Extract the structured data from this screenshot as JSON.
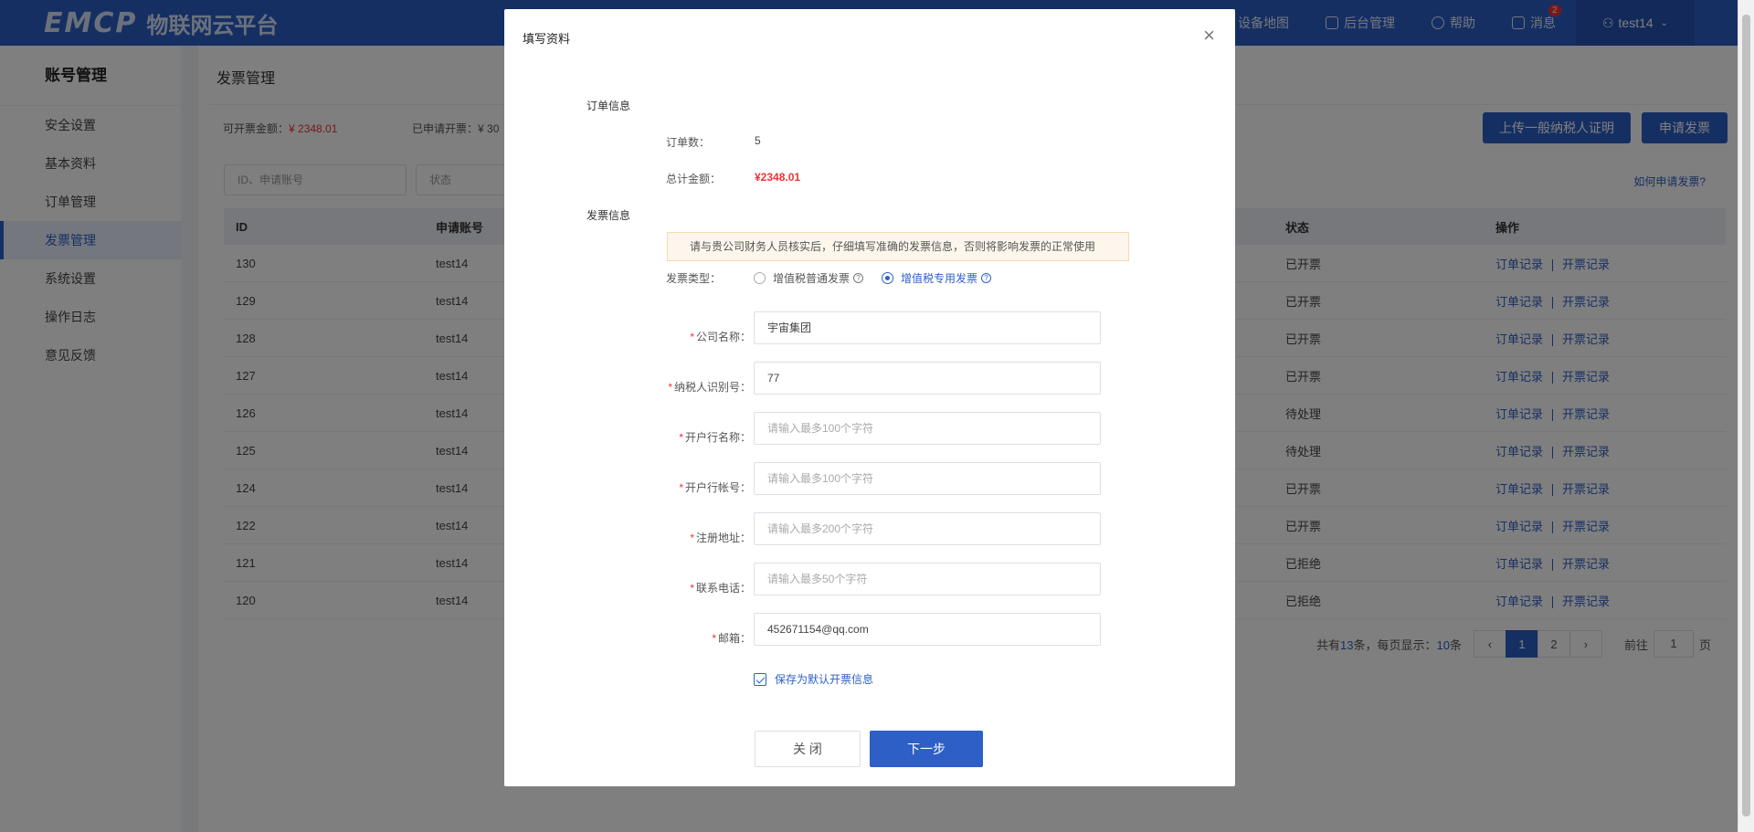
{
  "header": {
    "logo_mark": "EMCP",
    "logo_text": "物联网云平台",
    "nav": [
      {
        "label": "设备地图",
        "icon": "user-pin-icon"
      },
      {
        "label": "后台管理",
        "icon": "monitor-icon"
      },
      {
        "label": "帮助",
        "icon": "help-circle-icon"
      },
      {
        "label": "消息",
        "icon": "message-icon"
      }
    ],
    "message_badge": "2",
    "user": "test14"
  },
  "sidebar": {
    "title": "账号管理",
    "items": [
      {
        "label": "安全设置"
      },
      {
        "label": "基本资料"
      },
      {
        "label": "订单管理"
      },
      {
        "label": "发票管理"
      },
      {
        "label": "系统设置"
      },
      {
        "label": "操作日志"
      },
      {
        "label": "意见反馈"
      }
    ],
    "active_index": 3
  },
  "main": {
    "page_title": "发票管理",
    "available_label": "可开票金额：",
    "available_amount": "¥ 2348.01",
    "applied_label": "已申请开票：",
    "applied_amount": "¥ 30",
    "upload_button": "上传一般纳税人证明",
    "apply_button": "申请发票",
    "filter_placeholder": "ID、申请账号",
    "status_placeholder": "状态",
    "help_link": "如何申请发票?",
    "table": {
      "columns": [
        "ID",
        "申请账号",
        "状态",
        "操作"
      ],
      "rows": [
        {
          "id": "130",
          "account": "test14",
          "status": "已开票"
        },
        {
          "id": "129",
          "account": "test14",
          "status": "已开票"
        },
        {
          "id": "128",
          "account": "test14",
          "status": "已开票"
        },
        {
          "id": "127",
          "account": "test14",
          "status": "已开票"
        },
        {
          "id": "126",
          "account": "test14",
          "status": "待处理"
        },
        {
          "id": "125",
          "account": "test14",
          "status": "待处理"
        },
        {
          "id": "124",
          "account": "test14",
          "status": "已开票"
        },
        {
          "id": "122",
          "account": "test14",
          "status": "已开票"
        },
        {
          "id": "121",
          "account": "test14",
          "status": "已拒绝"
        },
        {
          "id": "120",
          "account": "test14",
          "status": "已拒绝"
        }
      ],
      "op_order": "订单记录",
      "op_invoice": "开票记录"
    },
    "pager": {
      "total_prefix": "共有",
      "total": "13",
      "total_mid": "条，每页显示：",
      "per_page": "10",
      "total_suffix": "条",
      "prev": "‹",
      "pages": [
        "1",
        "2"
      ],
      "next": "›",
      "goto_prefix": "前往",
      "goto_value": "1",
      "goto_suffix": "页"
    }
  },
  "modal": {
    "title": "填写资料",
    "close": "×",
    "order_section": "订单信息",
    "order_count_label": "订单数：",
    "order_count": "5",
    "total_label": "总计金额：",
    "total_amount": "¥2348.01",
    "invoice_section": "发票信息",
    "notice": "请与贵公司财务人员核实后，仔细填写准确的发票信息，否则将影响发票的正常使用",
    "type_label": "发票类型：",
    "type_option_normal": "增值税普通发票",
    "type_option_special": "增值税专用发票",
    "fields": [
      {
        "label": "公司名称：",
        "value": "宇宙集团",
        "placeholder": ""
      },
      {
        "label": "纳税人识别号：",
        "value": "77",
        "placeholder": ""
      },
      {
        "label": "开户行名称：",
        "value": "",
        "placeholder": "请输入最多100个字符"
      },
      {
        "label": "开户行帐号：",
        "value": "",
        "placeholder": "请输入最多100个字符"
      },
      {
        "label": "注册地址：",
        "value": "",
        "placeholder": "请输入最多200个字符"
      },
      {
        "label": "联系电话：",
        "value": "",
        "placeholder": "请输入最多50个字符"
      },
      {
        "label": "邮箱：",
        "value": "452671154@qq.com",
        "placeholder": ""
      }
    ],
    "save_default": "保存为默认开票信息",
    "close_button": "关 闭",
    "next_button": "下一步"
  },
  "colors": {
    "primary": "#2d5fc6",
    "danger": "#e33",
    "overlay": "rgba(0,0,0,0.5)"
  }
}
